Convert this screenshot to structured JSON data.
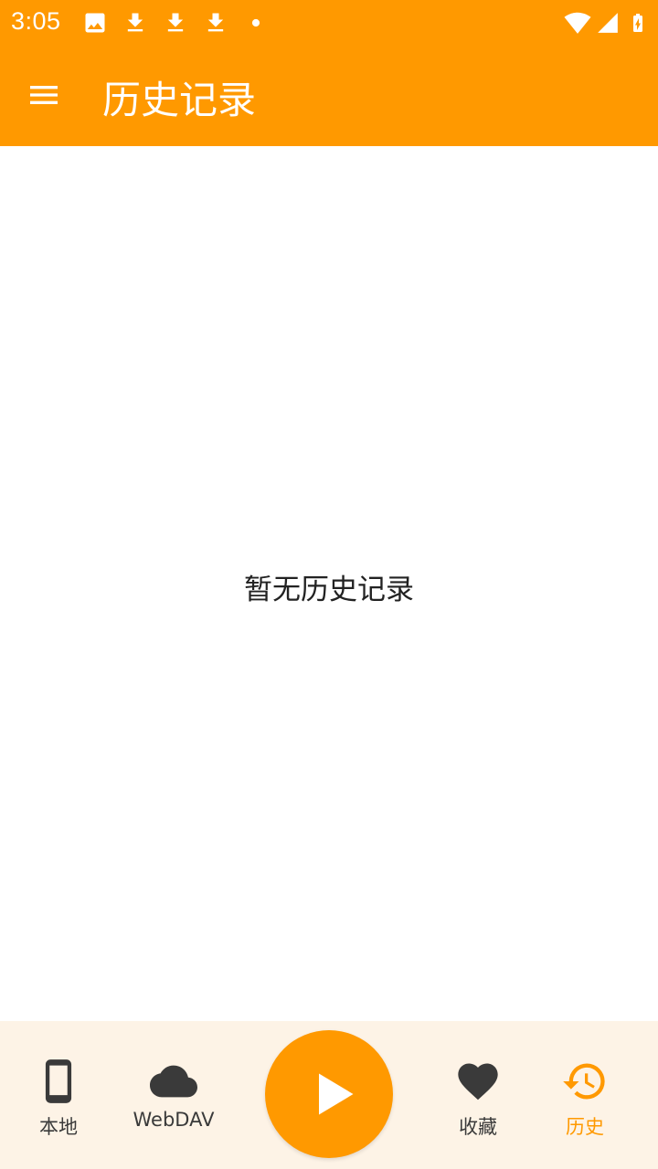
{
  "status_bar": {
    "time": "3:05",
    "icons": [
      "image-icon",
      "download-icon",
      "download-icon",
      "download-icon",
      "dot-icon",
      "wifi-icon",
      "signal-icon",
      "battery-charging-icon"
    ]
  },
  "app_bar": {
    "title": "历史记录",
    "menu_icon": "menu-icon"
  },
  "main": {
    "empty_message": "暂无历史记录"
  },
  "bottom_nav": {
    "items": [
      {
        "label": "本地",
        "icon": "phone-icon",
        "active": false
      },
      {
        "label": "WebDAV",
        "icon": "cloud-icon",
        "active": false
      },
      {
        "label": "收藏",
        "icon": "heart-icon",
        "active": false
      },
      {
        "label": "历史",
        "icon": "history-icon",
        "active": true
      }
    ],
    "fab_icon": "play-icon"
  },
  "colors": {
    "accent": "#ff9900",
    "nav_background": "#fdf3e6",
    "inactive_icon": "#3a3a3a",
    "text_primary": "#222222"
  }
}
